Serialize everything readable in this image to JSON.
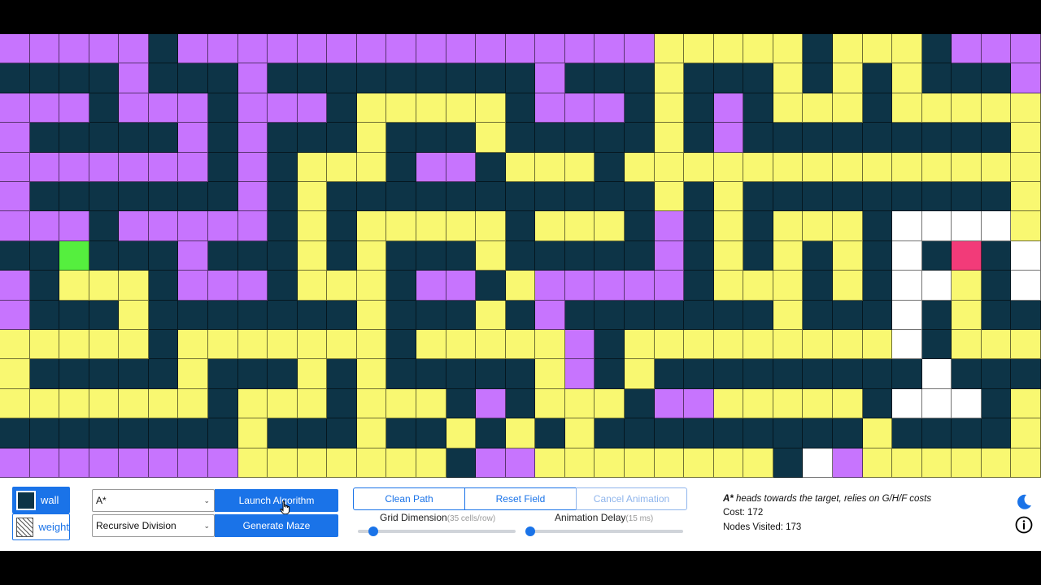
{
  "colors": {
    "wall": "#0d3447",
    "path": "#f9f871",
    "visited": "#c774fe",
    "empty": "#ffffff",
    "start": "#55ef3e",
    "target": "#f23b79",
    "accent": "#1a73e8"
  },
  "grid": {
    "cols": 35,
    "rows": 15,
    "legend": {
      "#": "wall",
      "Y": "path",
      "P": "visited",
      ".": "empty",
      "S": "start",
      "T": "target"
    },
    "cells": [
      "PPPPP#PPPPPPPPPPPPPPPPYYYYY#YYY#PPP",
      "####P###P#########P###Y###Y#Y#Y###P",
      "PPP#PPP#PPP#YYYYY#PPP#Y#P#YYY#YYYYY",
      "P#####P#P###Y###Y#####Y#P#########Y",
      "PPPPPPP#P#YYY#PP#YYY#YYYYYYYYYYYYYY",
      "P#######P#Y###########Y#Y#########Y",
      "PPP#PPPPP#Y#YYYYY#YYY#P#Y#YYY#....Y",
      "##S###P###Y#Y###Y#####P#Y#Y#Y#.#T#.",
      "P#YYY#PPP#YYY#PP#YPPPPP#YYY#Y#..Y#.",
      "P###Y#######Y###Y#P#######Y###.#Y##",
      "YYYYY#YYYYYYY#YYYYYP#YYYYYYYYY.#YYY",
      "Y#####Y###Y#Y#####YP#Y#########.###",
      "YYYYYYY#YYY#YYY#P#YYY#PPYYYYY#...#Y",
      "########Y###Y##Y#Y#Y#########Y####Y",
      "PPPPPPPPYYYYYYY#PPYYYYYYYY#.PYYYYYY"
    ]
  },
  "controls": {
    "wall_label": "wall",
    "weight_label": "weight",
    "wall_icon": "wall-square-icon",
    "weight_icon": "hatched-square-icon",
    "algorithm_value": "A*",
    "launch_label": "Launch Algorithm",
    "maze_value": "Recursive Division",
    "generate_label": "Generate Maze",
    "clean_path_label": "Clean Path",
    "reset_field_label": "Reset Field",
    "cancel_animation_label": "Cancel Animation",
    "grid_dimension_label": "Grid Dimension",
    "grid_dimension_value": "(35 cells/row)",
    "grid_dimension_fraction": 0.1,
    "animation_delay_label": "Animation Delay",
    "animation_delay_value": "(15 ms)",
    "animation_delay_fraction": 0.02
  },
  "info": {
    "algorithm_name": "A*",
    "description": " heads towards the target, relies on G/H/F costs",
    "cost_text": "Cost: 172",
    "nodes_text": "Nodes Visited: 173"
  },
  "icons": {
    "theme": "moon-icon",
    "about": "info-icon",
    "cursor": "hand-pointer-icon"
  }
}
